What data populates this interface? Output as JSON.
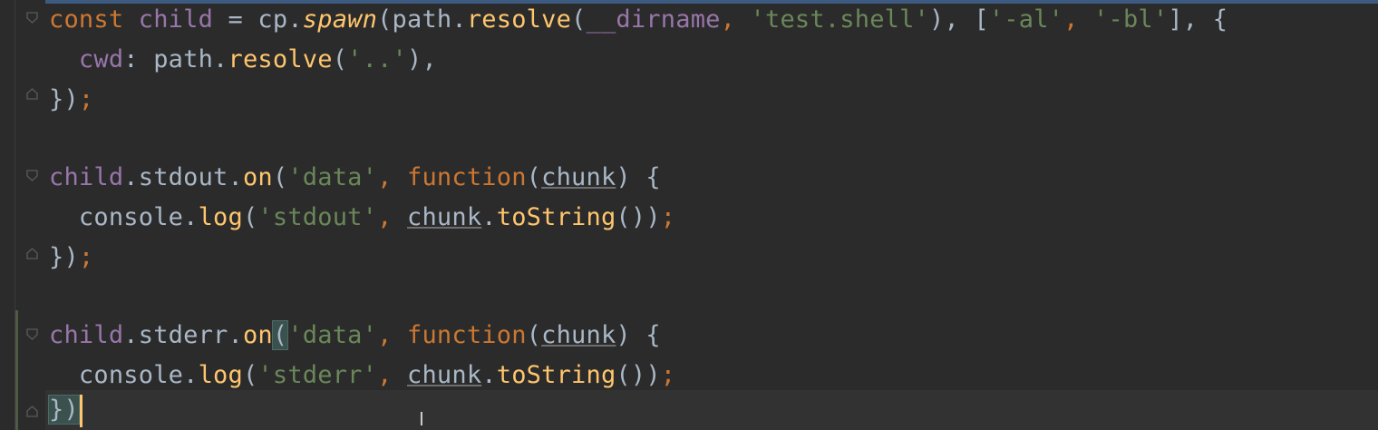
{
  "editor": {
    "lines": {
      "l1": {
        "a": "const",
        "b": " ",
        "c": "child",
        "d": " = ",
        "e": "cp",
        "f": ".",
        "g": "spawn",
        "h": "(",
        "i": "path",
        "j": ".",
        "k": "resolve",
        "l": "(",
        "m": "__dirname",
        "n": ", ",
        "o": "'test.shell'",
        "p": "), [",
        "q": "'-al'",
        "r": ", ",
        "s": "'-bl'",
        "t": "], {"
      },
      "l2": {
        "a": "  cwd",
        "b": ": ",
        "c": "path",
        "d": ".",
        "e": "resolve",
        "f": "(",
        "g": "'..'",
        "h": "),",
        "i": ""
      },
      "l3": {
        "a": "})",
        "b": ";"
      },
      "l5": {
        "a": "child",
        "b": ".",
        "c": "stdout",
        "d": ".",
        "e": "on",
        "f": "(",
        "g": "'data'",
        "h": ", ",
        "i": "function",
        "j": "(",
        "k": "chunk",
        "l": ") {"
      },
      "l6": {
        "a": "  console",
        "b": ".",
        "c": "log",
        "d": "(",
        "e": "'stdout'",
        "f": ", ",
        "g": "chunk",
        "h": ".",
        "i": "toString",
        "j": "())",
        "k": ";"
      },
      "l7": {
        "a": "})",
        "b": ";"
      },
      "l9": {
        "a": "child",
        "b": ".",
        "c": "stderr",
        "d": ".",
        "e": "on",
        "f": "(",
        "g": "'data'",
        "h": ", ",
        "i": "function",
        "j": "(",
        "k": "chunk",
        "l": ") {"
      },
      "l10": {
        "a": "  console",
        "b": ".",
        "c": "log",
        "d": "(",
        "e": "'stderr'",
        "f": ", ",
        "g": "chunk",
        "h": ".",
        "i": "toString",
        "j": "())",
        "k": ";"
      },
      "l11": {
        "a": "})"
      }
    },
    "icons": {
      "fold": "fold-marker-icon",
      "text_cursor": "text-cursor-icon"
    },
    "colors": {
      "background": "#2b2b2b",
      "keyword": "#cc7832",
      "string": "#6a8759",
      "function": "#ffc66d",
      "field": "#9876aa",
      "text": "#a9b7c6"
    }
  }
}
